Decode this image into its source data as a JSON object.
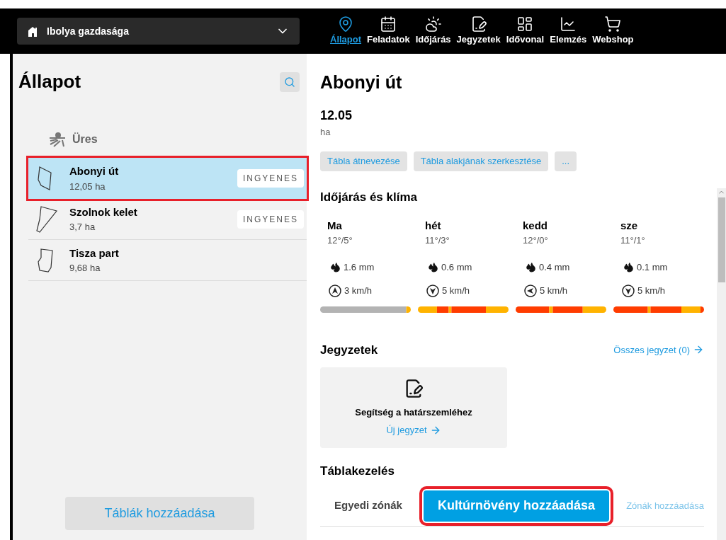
{
  "farm_selector": {
    "value": "Ibolya gazdasága"
  },
  "nav": [
    {
      "label": "Állapot",
      "selected": true
    },
    {
      "label": "Feladatok",
      "selected": false
    },
    {
      "label": "Időjárás",
      "selected": false
    },
    {
      "label": "Jegyzetek",
      "selected": false
    },
    {
      "label": "Idővonal",
      "selected": false
    },
    {
      "label": "Elemzés",
      "selected": false
    },
    {
      "label": "Webshop",
      "selected": false
    }
  ],
  "sidebar": {
    "title": "Állapot",
    "group": "Üres",
    "items": [
      {
        "name": "Abonyi út",
        "area": "12,05 ha",
        "badge": "INGYENES",
        "selected": true,
        "highlighted": true
      },
      {
        "name": "Szolnok kelet",
        "area": "3,7 ha",
        "badge": "INGYENES",
        "selected": false,
        "highlighted": false
      },
      {
        "name": "Tisza part",
        "area": "9,68 ha",
        "selected": false,
        "highlighted": false
      }
    ],
    "add_button": "Táblák hozzáadása"
  },
  "detail": {
    "title": "Abonyi út",
    "area_value": "12.05",
    "area_unit": "ha",
    "actions": [
      "Tábla átnevezése",
      "Tábla alakjának szerkesztése",
      "..."
    ],
    "weather": {
      "title": "Időjárás és klíma",
      "days": [
        {
          "day": "Ma",
          "temp": "12°/5°",
          "rain": "1.6 mm",
          "wind": "3 km/h",
          "kind": "north"
        },
        {
          "day": "hét",
          "temp": "11°/3°",
          "rain": "0.6 mm",
          "wind": "5 km/h",
          "kind": "south"
        },
        {
          "day": "kedd",
          "temp": "12°/0°",
          "rain": "0.4 mm",
          "wind": "5 km/h",
          "kind": "west"
        },
        {
          "day": "sze",
          "temp": "11°/1°",
          "rain": "0.1 mm",
          "wind": "5 km/h",
          "kind": "south"
        }
      ]
    },
    "notes": {
      "title": "Jegyzetek",
      "all_link": "Összes jegyzet (0)",
      "card_text": "Segítség a határszemléhez",
      "new_link": "Új jegyzet"
    },
    "management": {
      "title": "Táblakezelés",
      "label": "Egyedi zónák",
      "primary_button": "Kultúrnövény hozzáadása",
      "primary_highlighted": true,
      "link": "Zónák hozzáadása"
    }
  }
}
